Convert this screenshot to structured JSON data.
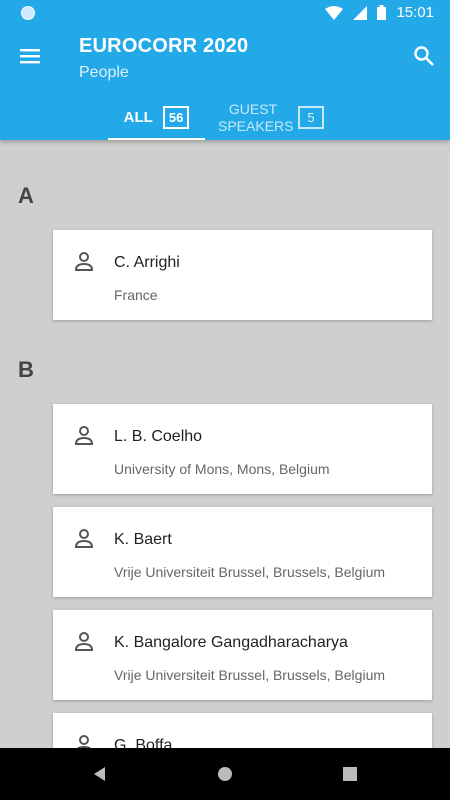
{
  "status_bar": {
    "time": "15:01"
  },
  "app_bar": {
    "title": "EUROCORR 2020",
    "subtitle": "People"
  },
  "tabs": [
    {
      "label": "ALL",
      "count": "56",
      "selected": true
    },
    {
      "label": "GUEST SPEAKERS",
      "count": "5",
      "selected": false
    }
  ],
  "sections": [
    {
      "letter": "A",
      "people": [
        {
          "name": "C. Arrighi",
          "affiliation": "France"
        }
      ]
    },
    {
      "letter": "B",
      "people": [
        {
          "name": "L. B. Coelho",
          "affiliation": "University of Mons, Mons, Belgium"
        },
        {
          "name": "K. Baert",
          "affiliation": "Vrije Universiteit Brussel, Brussels, Belgium"
        },
        {
          "name": "K. Bangalore Gangadharacharya",
          "affiliation": "Vrije Universiteit Brussel, Brussels, Belgium"
        },
        {
          "name": "G. Boffa",
          "affiliation": ""
        }
      ]
    }
  ],
  "colors": {
    "primary": "#23a9e8",
    "background": "#cfcfcf"
  },
  "icons": {
    "menu": "menu-icon",
    "search": "search-icon",
    "person": "person-icon",
    "wifi": "wifi-icon",
    "signal": "signal-icon",
    "battery": "battery-icon",
    "back": "back-icon",
    "home": "home-icon",
    "recents": "recents-icon"
  }
}
